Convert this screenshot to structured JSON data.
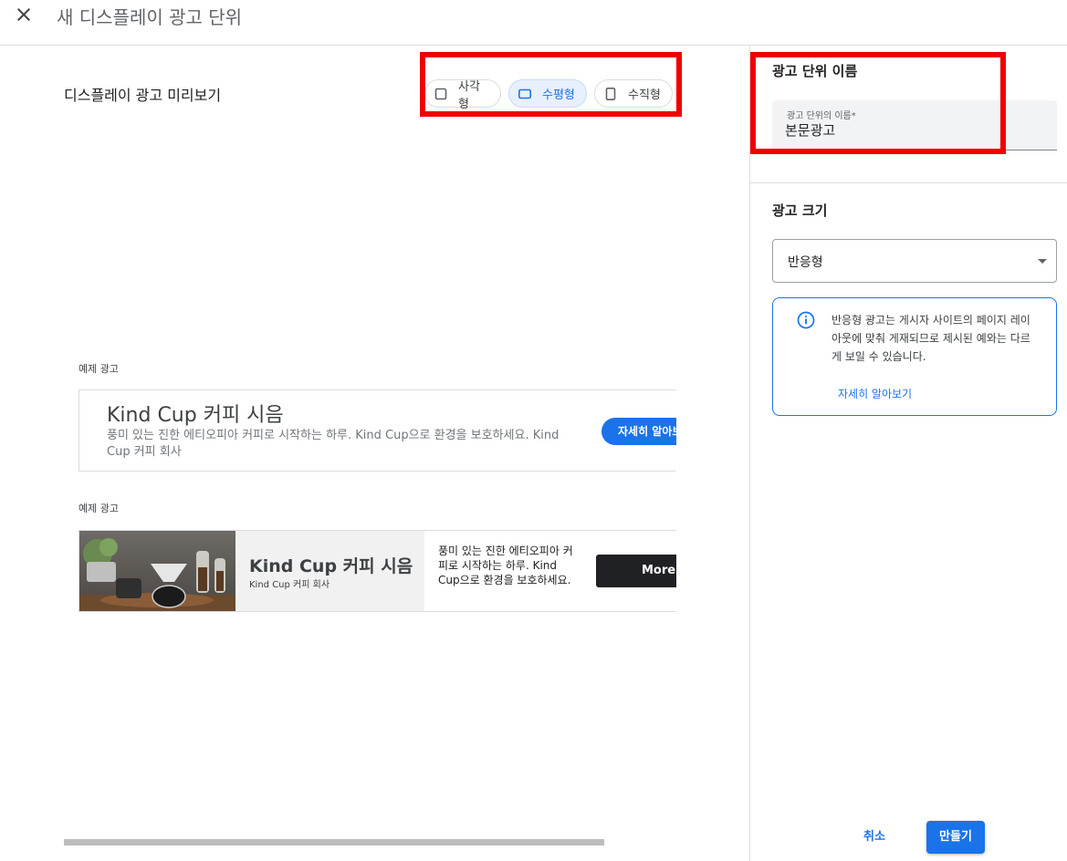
{
  "header": {
    "title": "새 디스플레이 광고 단위",
    "close_icon": "close-icon"
  },
  "preview": {
    "title": "디스플레이 광고 미리보기",
    "shapes": [
      {
        "label": "사각형",
        "icon": "square-icon",
        "selected": false
      },
      {
        "label": "수평형",
        "icon": "horizontal-rect-icon",
        "selected": true
      },
      {
        "label": "수직형",
        "icon": "vertical-rect-icon",
        "selected": false
      }
    ],
    "samples": [
      {
        "label": "예제 광고",
        "title": "Kind Cup 커피 시음",
        "body": "풍미 있는 진한 에티오피아 커피로 시작하는 하루. Kind Cup으로 환경을 보호하세요. Kind Cup 커피 회사",
        "cta": "자세히 알아보기"
      },
      {
        "label": "예제 광고",
        "title": "Kind Cup 커피 시음",
        "company": "Kind Cup 커피 회사",
        "body": "풍미 있는 진한 에티오피아 커피로 시작하는 하루. Kind Cup으로 환경을 보호하세요.",
        "cta": "More"
      }
    ]
  },
  "settings": {
    "name_section": {
      "title": "광고 단위 이름",
      "field_label": "광고 단위의 이름*",
      "field_value": "본문광고"
    },
    "size_section": {
      "title": "광고 크기",
      "selected": "반응형",
      "info_text": "반응형 광고는 게시자 사이트의 페이지 레이아웃에 맞춰 게재되므로 제시된 예와는 다르게 보일 수 있습니다.",
      "info_link": "자세히 알아보기"
    },
    "actions": {
      "cancel": "취소",
      "create": "만들기"
    }
  },
  "colors": {
    "accent": "#1a73e8",
    "highlight": "#ee0000",
    "selected_bg": "#e8f0fe"
  }
}
